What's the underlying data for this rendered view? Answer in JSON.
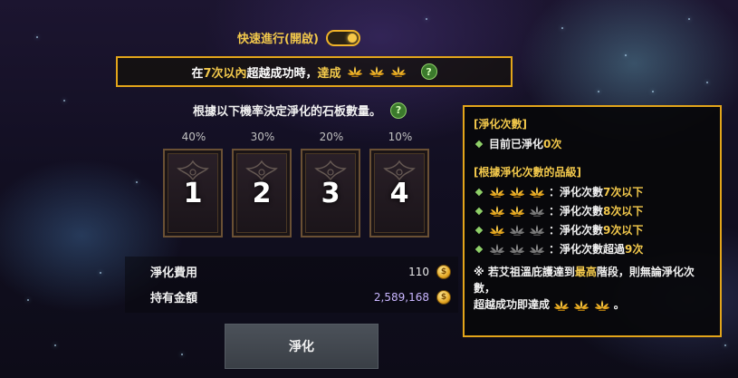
{
  "quick_toggle": {
    "label": "快速進行(開啟)",
    "state": "on"
  },
  "banner": {
    "pre": "在",
    "count": "7次以內",
    "mid": "超越成功時，",
    "post": "達成",
    "leaves": 3,
    "help": "?"
  },
  "rate_title": {
    "text": "根據以下機率決定淨化的石板數量。",
    "help": "?"
  },
  "slabs": [
    {
      "pct": "40%",
      "num": "1"
    },
    {
      "pct": "30%",
      "num": "2"
    },
    {
      "pct": "20%",
      "num": "3"
    },
    {
      "pct": "10%",
      "num": "4"
    }
  ],
  "cost": {
    "fee_label": "淨化費用",
    "fee_value": "110",
    "gold_label": "持有金額",
    "gold_value": "2,589,168"
  },
  "purify_button": "淨化",
  "info": {
    "section1_title": "[淨化次數]",
    "current_pre": "目前已淨化",
    "current_count": "0次",
    "section2_title": "[根據淨化次數的品級]",
    "grades": [
      {
        "gold": 3,
        "text_pre": "：淨化次數",
        "highlight": "7次以下",
        "text_post": ""
      },
      {
        "gold": 2,
        "text_pre": "：淨化次數",
        "highlight": "8次以下",
        "text_post": ""
      },
      {
        "gold": 1,
        "text_pre": "：淨化次數",
        "highlight": "9次以下",
        "text_post": ""
      },
      {
        "gold": 0,
        "text_pre": "：淨化次數超過",
        "highlight": "9次",
        "text_post": ""
      }
    ],
    "note_pre": "※ 若艾祖溫庇護達到",
    "note_highlight": "最高",
    "note_post": "階段，則無論淨化次數，",
    "note_line2": "超越成功即達成",
    "note_end": "。"
  },
  "colors": {
    "accent_gold": "#f2c84b",
    "border_gold": "#e3a51a",
    "check_green": "#8fd068"
  }
}
